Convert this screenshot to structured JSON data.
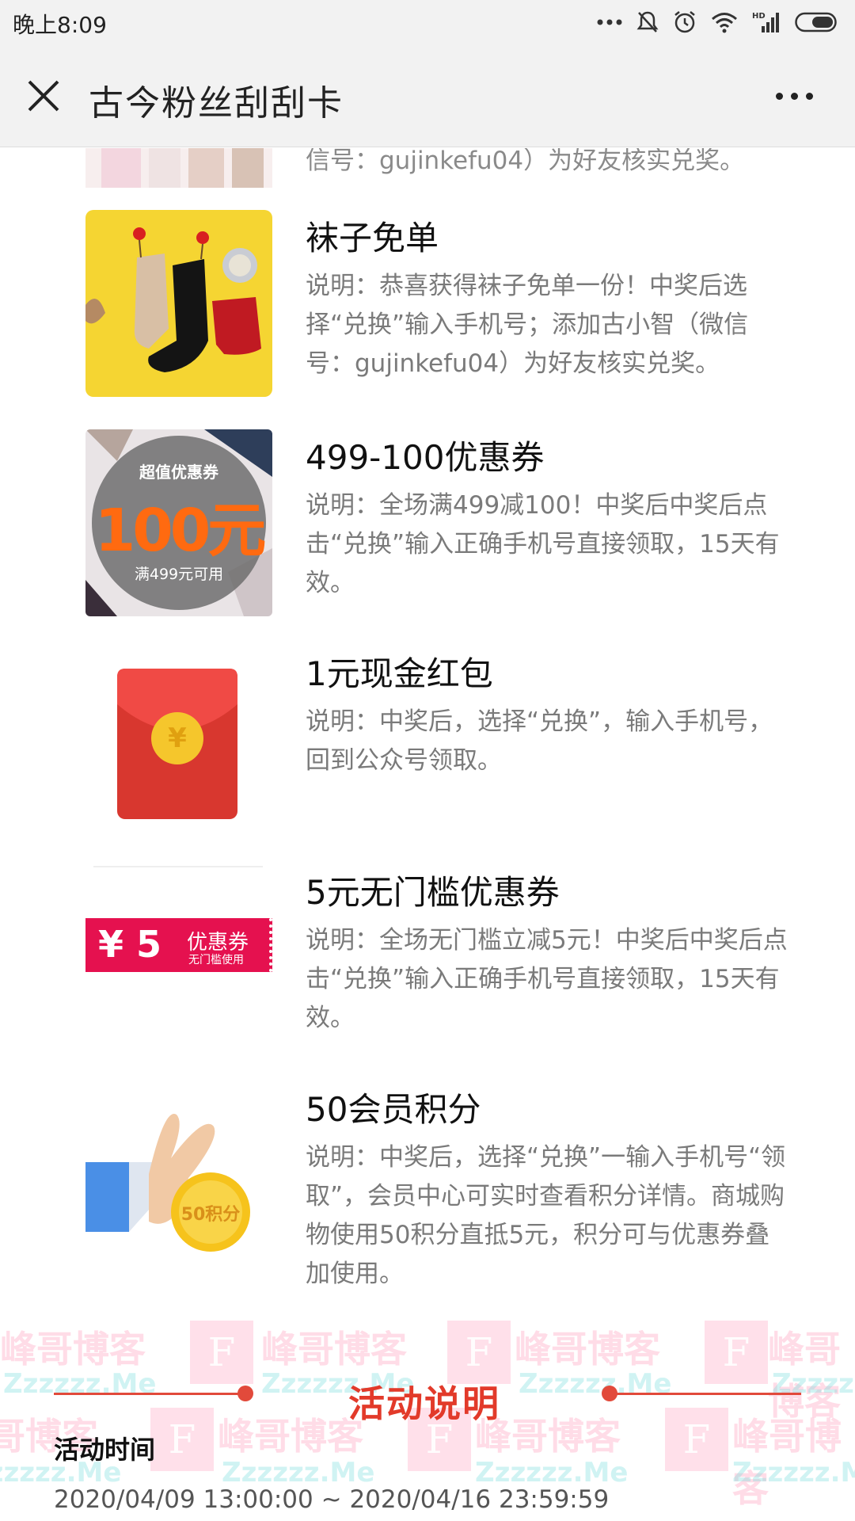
{
  "status_bar": {
    "time": "晚上8:09",
    "icons": [
      "more-dots-icon",
      "mute-bell-icon",
      "alarm-icon",
      "wifi-icon",
      "hd-signal-icon",
      "battery-icon"
    ]
  },
  "header": {
    "title": "古今粉丝刮刮卡",
    "close_icon": "close-icon",
    "more_icon": "more-icon"
  },
  "prizes": [
    {
      "name": "",
      "description_partial": "信号：gujinkefu04）为好友核实兑奖。",
      "image": "lingerie-photo"
    },
    {
      "name": "袜子免单",
      "description": "说明：恭喜获得袜子免单一份！中奖后选择“兑换”输入手机号；添加古小智（微信号：gujinkefu04）为好友核实兑奖。",
      "image": "socks-photo"
    },
    {
      "name": "499-100优惠券",
      "description": "说明：全场满499减100！中奖后中奖后点击“兑换”输入正确手机号直接领取，15天有效。",
      "image": "coupon-100",
      "image_text": {
        "top": "超值优惠券",
        "amount": "100元",
        "bottom": "满499元可用"
      }
    },
    {
      "name": "1元现金红包",
      "description": "说明：中奖后，选择“兑换”，输入手机号，回到公众号领取。",
      "image": "red-envelope",
      "image_text": {
        "symbol": "¥"
      }
    },
    {
      "name": "5元无门槛优惠券",
      "description": "说明：全场无门槛立减5元！中奖后中奖后点击“兑换”输入正确手机号直接领取，15天有效。",
      "image": "coupon-5",
      "image_text": {
        "amount": "¥ 5",
        "title": "优惠券",
        "subtitle": "无门槛使用"
      }
    },
    {
      "name": "50会员积分",
      "description": "说明：中奖后，选择“兑换”一输入手机号“领取”，会员中心可实时查看积分详情。商城购物使用50积分直抵5元，积分可与优惠券叠加使用。",
      "image": "points-coin",
      "image_text": {
        "coin": "50积分"
      }
    }
  ],
  "activity": {
    "section_title": "活动说明",
    "time_label": "活动时间",
    "time_value": "2020/04/09 13:00:00 ~ 2020/04/16 23:59:59"
  },
  "watermark": {
    "text": "峰哥博客",
    "sub": "Zzzzzz.Me",
    "letter": "F"
  },
  "colors": {
    "accent_red": "#e23a2a",
    "header_bg": "#f2f2f2",
    "desc_gray": "#7a7a7a",
    "coupon_pink": "#e5114f",
    "coupon_orange": "#ff6a10"
  }
}
